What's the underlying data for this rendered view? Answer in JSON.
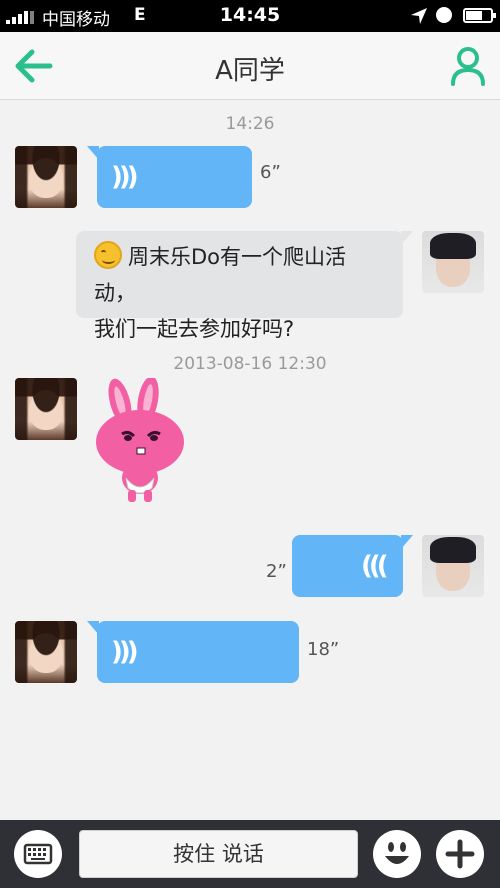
{
  "status_bar": {
    "carrier": "中国移动",
    "network": "E",
    "time": "14:45"
  },
  "nav": {
    "title": "A同学",
    "accent_color": "#2bbf8e"
  },
  "chat": {
    "messages": [
      {
        "type": "timestamp",
        "text": "14:26"
      },
      {
        "type": "voice",
        "sender": "other",
        "duration": "6”"
      },
      {
        "type": "text",
        "sender": "me",
        "text": "周末乐Do有一个爬山活动，我们一起去参加好吗?",
        "line1": "周末乐Do有一个爬山活动，",
        "line2": "我们一起去参加好吗?",
        "emoji": "smile"
      },
      {
        "type": "timestamp",
        "text": "2013-08-16  12:30"
      },
      {
        "type": "sticker",
        "sender": "other",
        "sticker": "pink-rabbit"
      },
      {
        "type": "voice",
        "sender": "me",
        "duration": "2”"
      },
      {
        "type": "voice",
        "sender": "other",
        "duration": "18”"
      }
    ]
  },
  "input_bar": {
    "talk_label": "按住  说话"
  },
  "colors": {
    "voice_bubble": "#62b5f7",
    "text_bubble": "#e3e4e6",
    "background": "#f2f2f2",
    "input_bar": "#2f3036"
  }
}
